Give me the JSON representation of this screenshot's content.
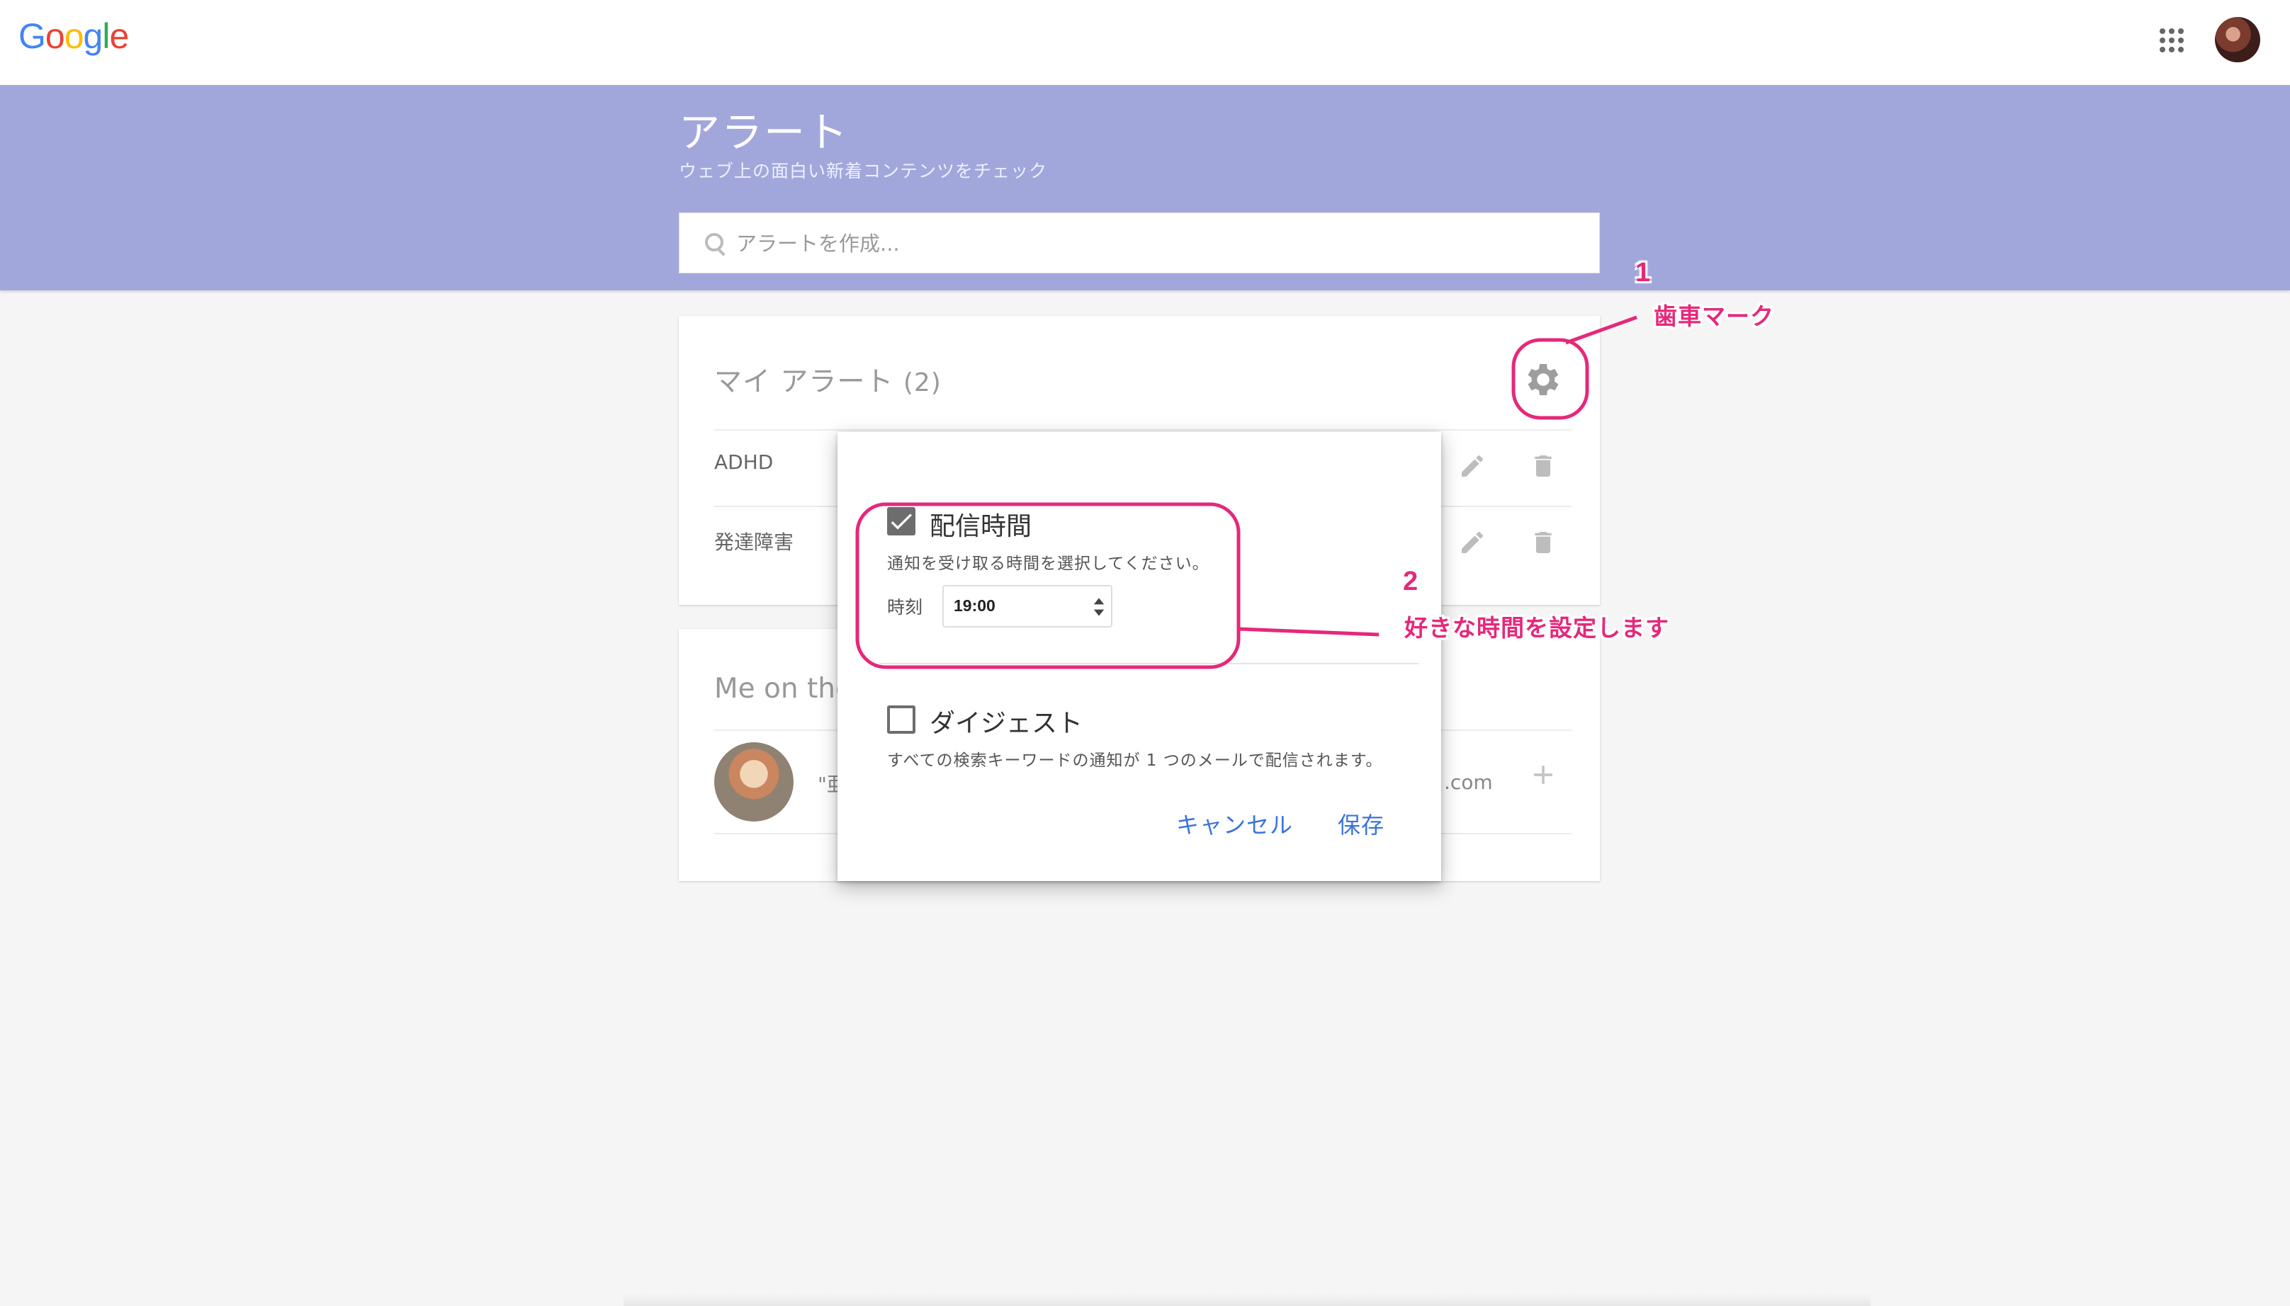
{
  "header": {
    "logo_letters": [
      {
        "char": "G",
        "color": "#4285F4"
      },
      {
        "char": "o",
        "color": "#EA4335"
      },
      {
        "char": "o",
        "color": "#FBBC05"
      },
      {
        "char": "g",
        "color": "#4285F4"
      },
      {
        "char": "l",
        "color": "#34A853"
      },
      {
        "char": "e",
        "color": "#EA4335"
      }
    ],
    "apps_icon": "apps-grid-icon",
    "account_avatar": "account-avatar"
  },
  "banner": {
    "title": "アラート",
    "subtitle": "ウェブ上の面白い新着コンテンツをチェック",
    "search_placeholder": "アラートを作成...",
    "color": "#a2a7db"
  },
  "my_alerts": {
    "title": "マイ アラート",
    "count": "(2)",
    "settings_icon": "gear-icon",
    "alerts": [
      {
        "label": "ADHD"
      },
      {
        "label": "発達障害"
      }
    ]
  },
  "me_on_web": {
    "title": "Me on the",
    "query_fragment": "\"亜",
    "email_fragment": ".com"
  },
  "settings_popup": {
    "delivery_time": {
      "label": "配信時間",
      "checked": true,
      "description": "通知を受け取る時間を選択してください。",
      "time_label": "時刻",
      "time_value": "19:00"
    },
    "digest": {
      "label": "ダイジェスト",
      "checked": false,
      "description": "すべての検索キーワードの通知が 1 つのメールで配信されます。"
    },
    "cancel_label": "キャンセル",
    "save_label": "保存",
    "button_color": "#3b74d9"
  },
  "annotations": {
    "color": "#e5287a",
    "note1_number": "1",
    "note1_text": "歯車マーク",
    "note2_number": "2",
    "note2_text": "好きな時間を設定します"
  }
}
